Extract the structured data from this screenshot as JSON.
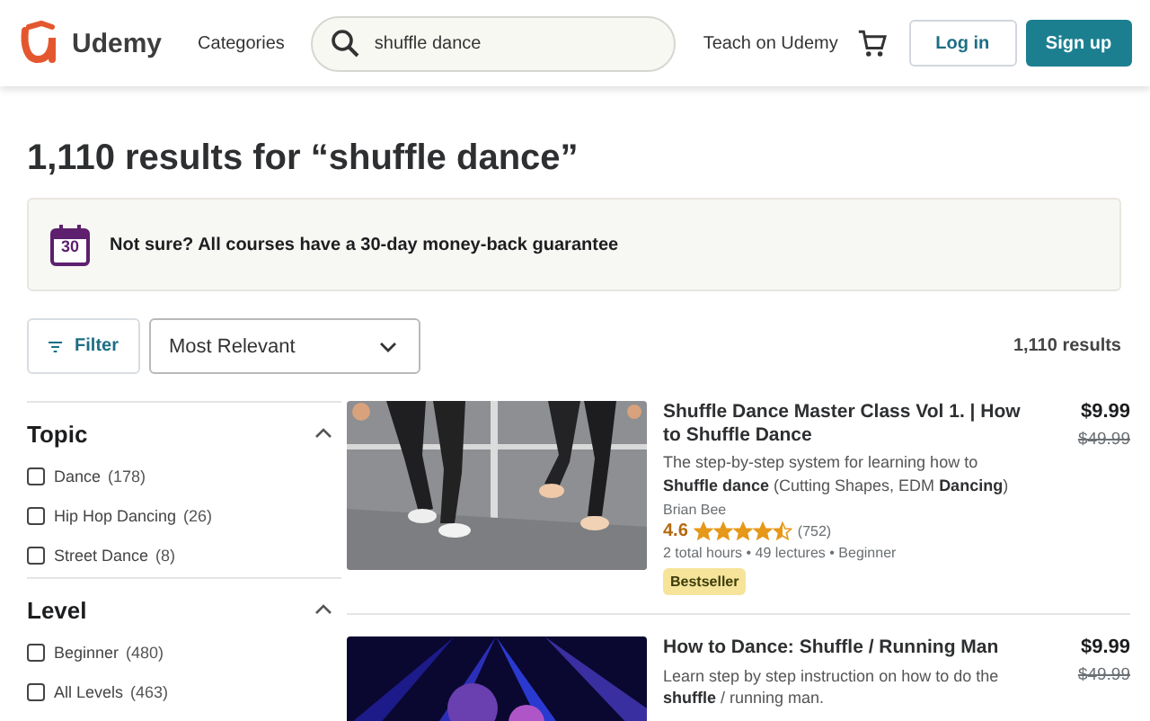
{
  "header": {
    "logo": "Udemy",
    "categories": "Categories",
    "search": {
      "value": "shuffle dance"
    },
    "teach": "Teach on Udemy",
    "login": "Log in",
    "signup": "Sign up"
  },
  "heading": "1,110 results for “shuffle dance”",
  "banner": {
    "day": "30",
    "text": "Not sure? All courses have a 30-day money-back guarantee"
  },
  "toolbar": {
    "filter": "Filter",
    "sort": "Most Relevant",
    "count": "1,110 results"
  },
  "filters": [
    {
      "title": "Topic",
      "expanded": true,
      "options": [
        {
          "label": "Dance",
          "count": "(178)",
          "checked": false
        },
        {
          "label": "Hip Hop Dancing",
          "count": "(26)",
          "checked": false
        },
        {
          "label": "Street Dance",
          "count": "(8)",
          "checked": false
        }
      ]
    },
    {
      "title": "Level",
      "expanded": true,
      "options": [
        {
          "label": "Beginner",
          "count": "(480)",
          "checked": false
        },
        {
          "label": "All Levels",
          "count": "(463)",
          "checked": false
        }
      ]
    }
  ],
  "courses": [
    {
      "kind": "picture",
      "title": "Shuffle Dance Master Class Vol 1. | How to Shuffle Dance",
      "description": "The step-by-step system for learning how to **Shuffle dance** (Cutting Shapes, EDM **Dancing**)",
      "instructor": "Brian Bee",
      "rating": "4.6",
      "stars": 4.5,
      "reviews": "(752)",
      "meta": "2 total hours • 49 lectures • Beginner",
      "badge": "Bestseller",
      "price": "$9.99",
      "old_price": "$49.99"
    },
    {
      "kind": "picture",
      "title": "How to Dance: Shuffle / Running Man",
      "description": "Learn step by step instruction on how to do the **shuffle** / running man.",
      "price": "$9.99",
      "old_price": "$49.99"
    }
  ]
}
